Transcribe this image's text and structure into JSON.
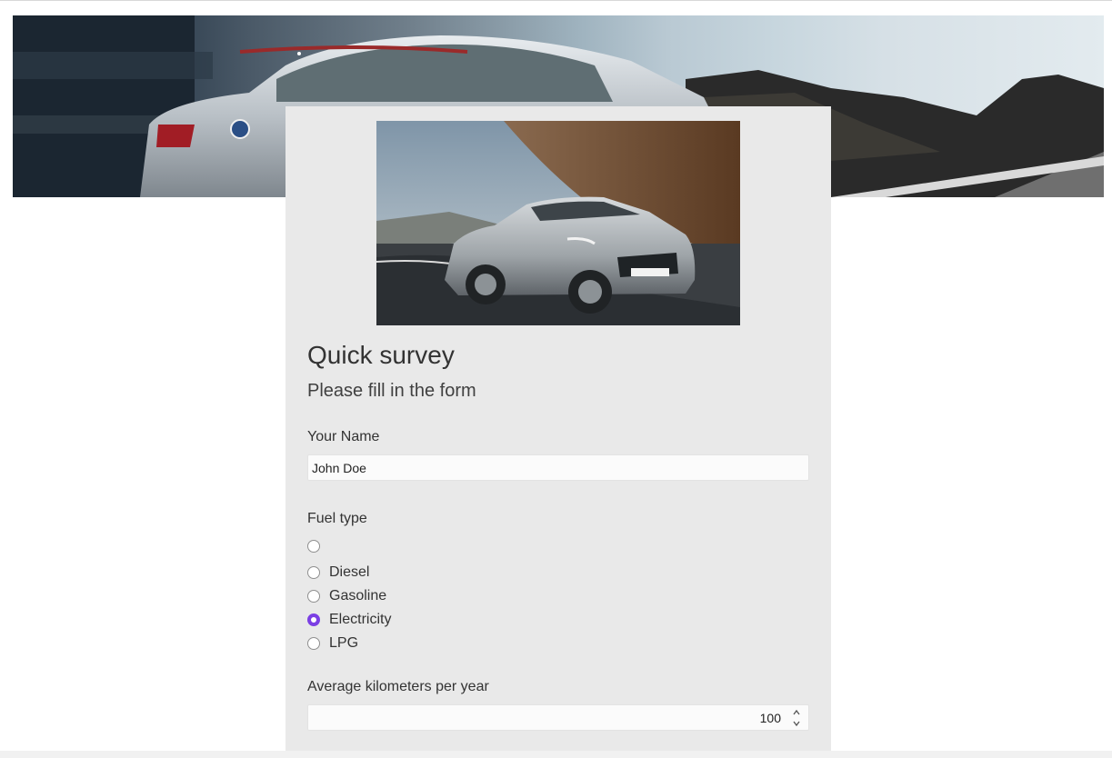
{
  "banner": {
    "alt": "Car banner"
  },
  "hero": {
    "alt": "Car image"
  },
  "survey": {
    "title": "Quick survey",
    "subtitle": "Please fill in the form"
  },
  "fields": {
    "name": {
      "label": "Your Name",
      "value": "John Doe"
    },
    "fuel": {
      "label": "Fuel type",
      "options": [
        {
          "label": "",
          "checked": false
        },
        {
          "label": "Diesel",
          "checked": false
        },
        {
          "label": "Gasoline",
          "checked": false
        },
        {
          "label": "Electricity",
          "checked": true
        },
        {
          "label": "LPG",
          "checked": false
        }
      ]
    },
    "km": {
      "label": "Average kilometers per year",
      "value": "100"
    }
  },
  "colors": {
    "accent": "#7b3fe4",
    "card_bg": "#e9e9e9"
  },
  "icons": {
    "spinner_up": "chevron-up-icon",
    "spinner_down": "chevron-down-icon"
  }
}
